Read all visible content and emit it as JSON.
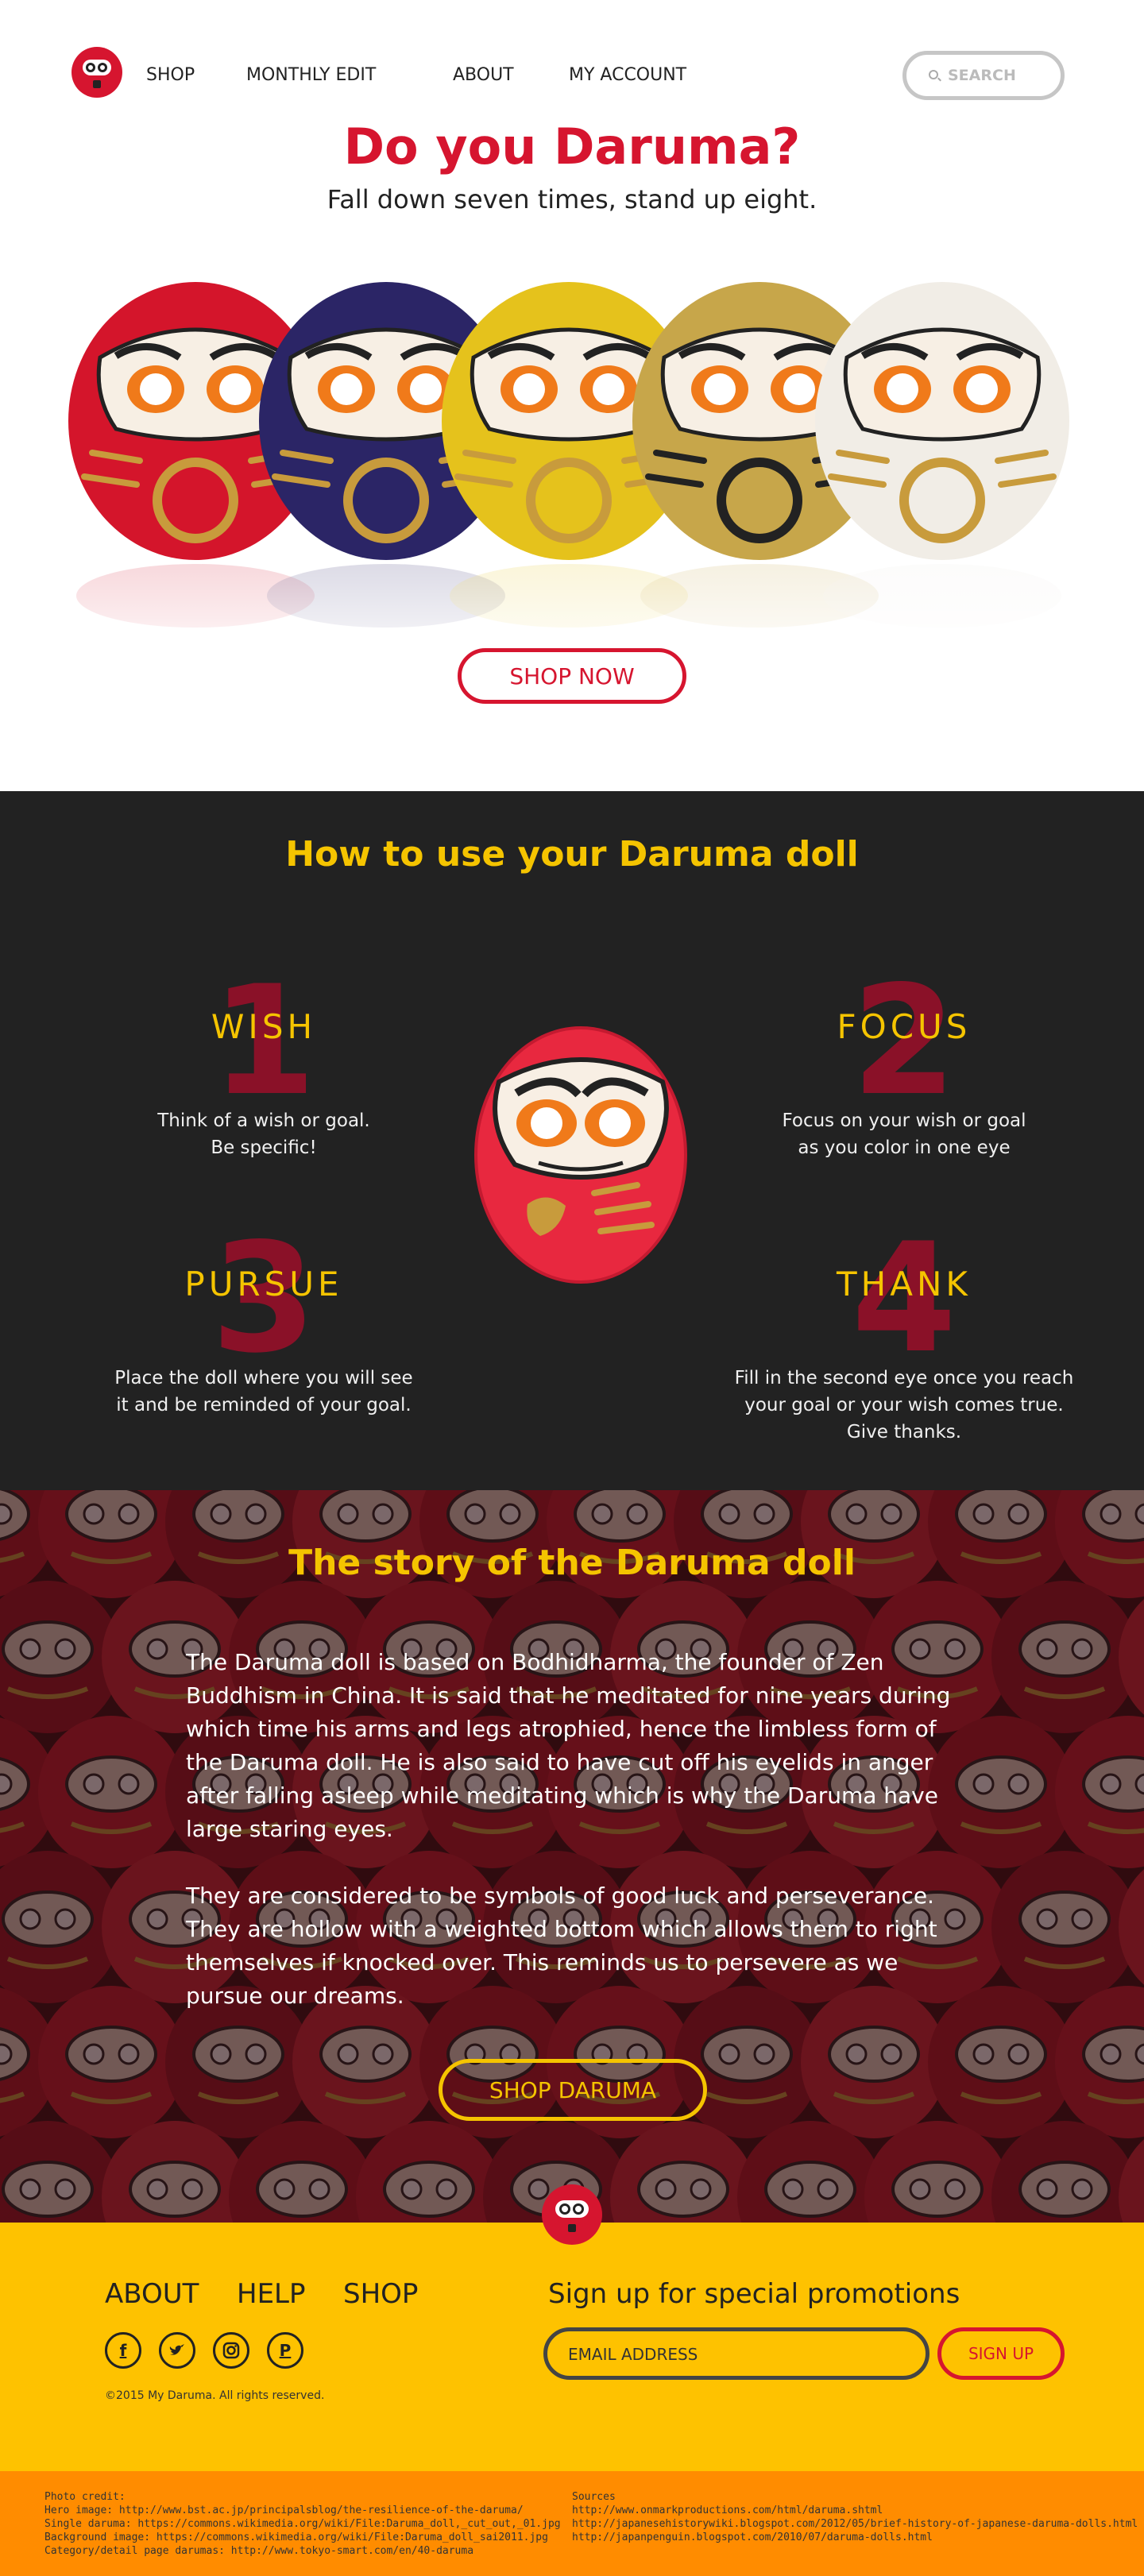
{
  "nav": {
    "items": [
      "SHOP",
      "MONTHLY EDIT",
      "ABOUT",
      "MY ACCOUNT"
    ],
    "search_placeholder": "SEARCH"
  },
  "hero": {
    "title": "Do you Daruma?",
    "subtitle": "Fall down seven times, stand up eight.",
    "doll_colors": [
      "#d4152b",
      "#2b2566",
      "#e5c21c",
      "#c7a64a",
      "#f1ede6"
    ],
    "cta": "SHOP NOW"
  },
  "howto": {
    "title": "How to use your Daruma doll",
    "steps": [
      {
        "num": "1",
        "name": "WISH",
        "desc": [
          "Think of a wish or  goal.",
          "Be specific!"
        ]
      },
      {
        "num": "2",
        "name": "FOCUS",
        "desc": [
          "Focus on your wish or goal",
          "as you color in one eye"
        ]
      },
      {
        "num": "3",
        "name": "PURSUE",
        "desc": [
          "Place the doll where you will see",
          "it and be reminded of your goal."
        ]
      },
      {
        "num": "4",
        "name": "THANK",
        "desc": [
          "Fill in the second eye once you reach",
          "your goal or your wish comes true.",
          "Give thanks."
        ]
      }
    ]
  },
  "story": {
    "title": "The story of the Daruma doll",
    "p1": "The Daruma doll is based on Bodhidharma, the founder of Zen Buddhism in China. It is said that he meditated for nine years during which time his arms and legs atrophied, hence the limbless form of the Daruma doll. He is also said to have cut off his eyelids in anger after falling asleep while meditating which is why the Daruma have large staring eyes.",
    "p2": "They are considered to be symbols of good luck and perseverance. They are hollow with a weighted bottom  which allows them to right themselves if knocked over. This reminds us to persevere as we pursue our dreams.",
    "cta": "SHOP DARUMA"
  },
  "footer": {
    "links": [
      "ABOUT",
      "HELP",
      "SHOP"
    ],
    "social": [
      "facebook-icon",
      "twitter-icon",
      "instagram-icon",
      "pinterest-icon"
    ],
    "copyright": "©2015 My Daruma. All rights reserved.",
    "promo_title": "Sign up for special promotions",
    "email_placeholder": "EMAIL ADDRESS",
    "signup": "SIGN UP"
  },
  "credits": {
    "left": [
      "Photo credit:",
      "Hero image: http://www.bst.ac.jp/principalsblog/the-resilience-of-the-daruma/",
      "Single daruma: https://commons.wikimedia.org/wiki/File:Daruma_doll,_cut_out,_01.jpg",
      "Background image: https://commons.wikimedia.org/wiki/File:Daruma_doll_sai2011.jpg",
      "Category/detail page darumas: http://www.tokyo-smart.com/en/40-daruma"
    ],
    "right": [
      "Sources",
      "http://www.onmarkproductions.com/html/daruma.shtml",
      "http://japanesehistorywiki.blogspot.com/2012/05/brief-history-of-japanese-daruma-dolls.html",
      "http://japanpenguin.blogspot.com/2010/07/daruma-dolls.html"
    ]
  },
  "colors": {
    "brand_red": "#d6152f",
    "accent_yellow": "#f5c400",
    "footer_yellow": "#fec200",
    "credits_orange": "#ff8c00",
    "dark": "#222222"
  }
}
